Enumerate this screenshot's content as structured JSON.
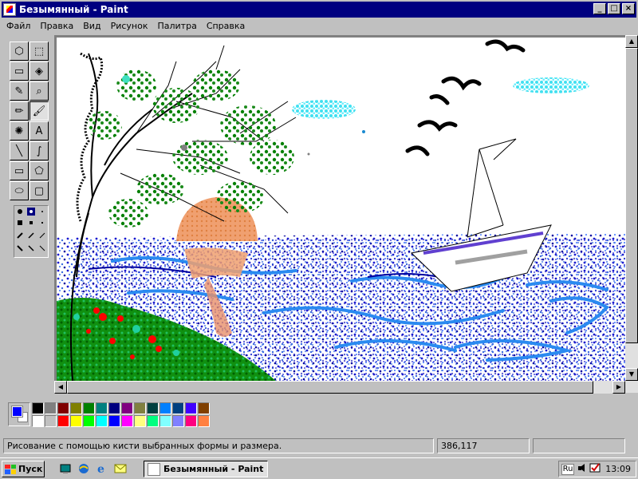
{
  "window": {
    "title": "Безымянный - Paint",
    "min_label": "_",
    "max_label": "□",
    "close_label": "×"
  },
  "menu": [
    {
      "label": "Файл"
    },
    {
      "label": "Правка"
    },
    {
      "label": "Вид"
    },
    {
      "label": "Рисунок"
    },
    {
      "label": "Палитра"
    },
    {
      "label": "Справка"
    }
  ],
  "tools": [
    {
      "name": "free-select-icon",
      "glyph": "⬡"
    },
    {
      "name": "rect-select-icon",
      "glyph": "⬚"
    },
    {
      "name": "eraser-icon",
      "glyph": "▭"
    },
    {
      "name": "fill-icon",
      "glyph": "◈"
    },
    {
      "name": "color-picker-icon",
      "glyph": "✎"
    },
    {
      "name": "magnifier-icon",
      "glyph": "⌕"
    },
    {
      "name": "pencil-icon",
      "glyph": "✏"
    },
    {
      "name": "brush-icon",
      "glyph": "🖌"
    },
    {
      "name": "airbrush-icon",
      "glyph": "✺"
    },
    {
      "name": "text-icon",
      "glyph": "A"
    },
    {
      "name": "line-icon",
      "glyph": "╲"
    },
    {
      "name": "curve-icon",
      "glyph": "∫"
    },
    {
      "name": "rectangle-icon",
      "glyph": "▭"
    },
    {
      "name": "polygon-icon",
      "glyph": "⬠"
    },
    {
      "name": "ellipse-icon",
      "glyph": "⬭"
    },
    {
      "name": "rounded-rect-icon",
      "glyph": "▢"
    }
  ],
  "palette": {
    "foreground": "#0000ff",
    "background": "#ffffff",
    "row1": [
      "#000000",
      "#808080",
      "#800000",
      "#808000",
      "#008000",
      "#008080",
      "#000080",
      "#800080",
      "#808040",
      "#004040",
      "#0080ff",
      "#004080",
      "#4000ff",
      "#804000"
    ],
    "row2": [
      "#ffffff",
      "#c0c0c0",
      "#ff0000",
      "#ffff00",
      "#00ff00",
      "#00ffff",
      "#0000ff",
      "#ff00ff",
      "#ffff80",
      "#00ff80",
      "#80ffff",
      "#8080ff",
      "#ff0080",
      "#ff8040"
    ]
  },
  "status": {
    "hint": "Рисование с помощью кисти выбранных формы и размера.",
    "coords": "386,117",
    "size": ""
  },
  "taskbar": {
    "start_label": "Пуск",
    "task_label": "Безымянный - Paint",
    "lang": "Ru",
    "clock": "13:09"
  }
}
